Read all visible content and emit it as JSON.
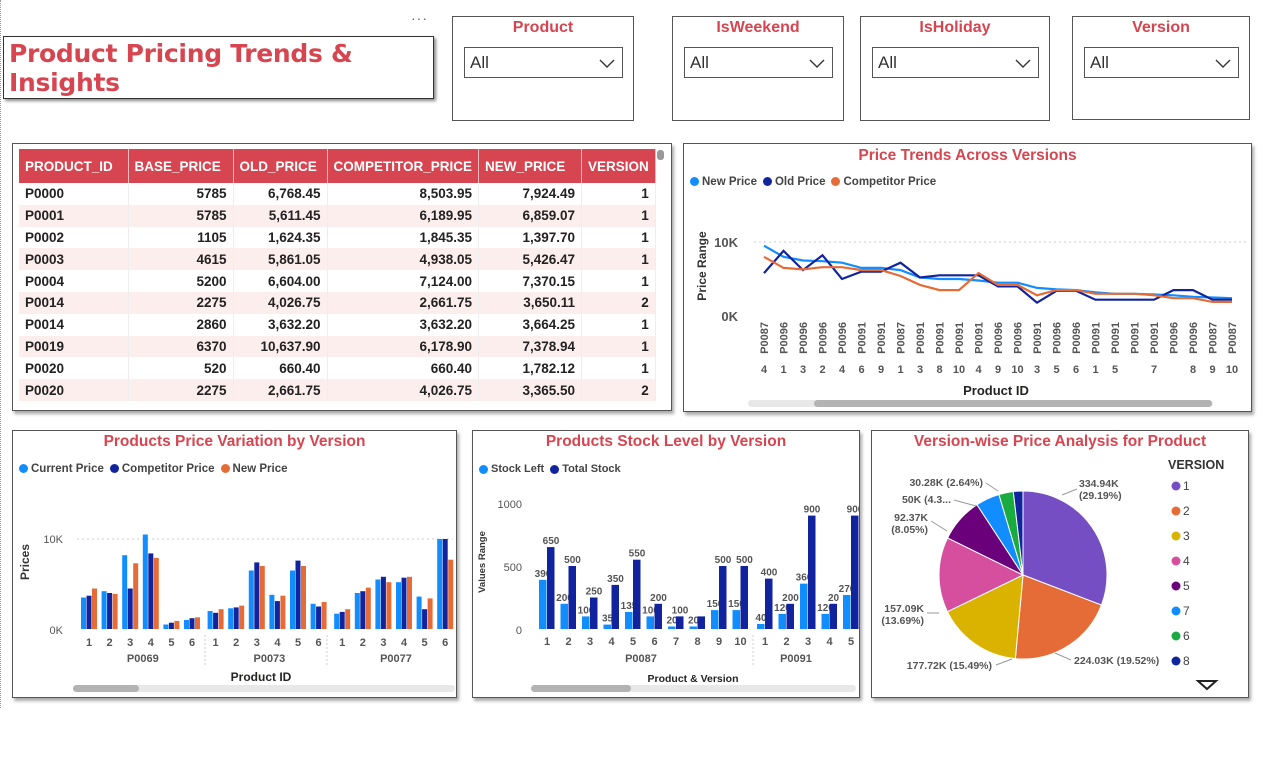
{
  "page": {
    "title": "Product Pricing Trends & Insights",
    "more_options": "···"
  },
  "slicers": [
    {
      "label": "Product",
      "value": "All"
    },
    {
      "label": "IsWeekend",
      "value": "All"
    },
    {
      "label": "IsHoliday",
      "value": "All"
    },
    {
      "label": "Version",
      "value": "All"
    }
  ],
  "table": {
    "columns": [
      "PRODUCT_ID",
      "BASE_PRICE",
      "OLD_PRICE",
      "COMPETITOR_PRICE",
      "NEW_PRICE",
      "VERSION"
    ],
    "rows": [
      [
        "P0000",
        "5785",
        "6,768.45",
        "8,503.95",
        "7,924.49",
        "1"
      ],
      [
        "P0001",
        "5785",
        "5,611.45",
        "6,189.95",
        "6,859.07",
        "1"
      ],
      [
        "P0002",
        "1105",
        "1,624.35",
        "1,845.35",
        "1,397.70",
        "1"
      ],
      [
        "P0003",
        "4615",
        "5,861.05",
        "4,938.05",
        "5,426.47",
        "1"
      ],
      [
        "P0004",
        "5200",
        "6,604.00",
        "7,124.00",
        "7,370.15",
        "1"
      ],
      [
        "P0014",
        "2275",
        "4,026.75",
        "2,661.75",
        "3,650.11",
        "2"
      ],
      [
        "P0014",
        "2860",
        "3,632.20",
        "3,632.20",
        "3,664.25",
        "1"
      ],
      [
        "P0019",
        "6370",
        "10,637.90",
        "6,178.90",
        "7,378.94",
        "1"
      ],
      [
        "P0020",
        "520",
        "660.40",
        "660.40",
        "1,782.12",
        "1"
      ],
      [
        "P0020",
        "2275",
        "2,661.75",
        "4,026.75",
        "3,365.50",
        "2"
      ]
    ]
  },
  "colors": {
    "accent": "#d64550",
    "light_blue": "#118dff",
    "dark_blue": "#12239e",
    "orange": "#e66c37"
  },
  "charts": {
    "trends": {
      "title": "Price Trends Across Versions",
      "legend": [
        "New Price",
        "Old Price",
        "Competitor Price"
      ],
      "xlabel": "Product ID",
      "ylabel": "Price Range",
      "yticks": [
        "10K",
        "0K"
      ]
    },
    "variation": {
      "title": "Products Price Variation by Version",
      "legend": [
        "Current Price",
        "Competitor Price",
        "New Price"
      ],
      "xlabel": "Product ID",
      "ylabel": "Prices",
      "yticks": [
        "10K",
        "0K"
      ]
    },
    "stock": {
      "title": "Products Stock Level by Version",
      "legend": [
        "Stock Left",
        "Total Stock"
      ],
      "xlabel": "Product & Version",
      "ylabel": "Values Range",
      "yticks": [
        "1000",
        "500",
        "0"
      ]
    },
    "pie": {
      "title": "Version-wise Price Analysis for Product",
      "legend_title": "VERSION",
      "labels": [
        "334.94K\n(29.19%)",
        "224.03K (19.52%)",
        "177.72K (15.49%)",
        "157.09K\n(13.69%)",
        "92.37K\n(8.05%)",
        "50K (4.3...",
        "30.28K (2.64%)"
      ]
    }
  },
  "chart_data": [
    {
      "type": "line",
      "title": "Price Trends Across Versions",
      "xlabel": "Product ID",
      "ylabel": "Price Range",
      "x": [
        "P0087 4",
        "P0096 1",
        "P0096 3",
        "P0096 2",
        "P0096 4",
        "P0091 6",
        "P0091 9",
        "P0087 1",
        "P0091 3",
        "P0091 8",
        "P0091 10",
        "P0091 4",
        "P0096 9",
        "P0096 10",
        "P0091 3",
        "P0096 5",
        "P0096 6",
        "P0091 1",
        "P0091 5",
        "P0091",
        "P0091 7",
        "P0096",
        "P0096 8",
        "P0087 9",
        "P0087 10"
      ],
      "x_tick_ids": [
        "P0087",
        "P0096",
        "P0096",
        "P0096",
        "P0096",
        "P0091",
        "P0091",
        "P0087",
        "P0091",
        "P0091",
        "P0091",
        "P0091",
        "P0096",
        "P0096",
        "P0091",
        "P0096",
        "P0096",
        "P0091",
        "P0091",
        "P0091",
        "P0091",
        "P0096",
        "P0096",
        "P0087",
        "P0087"
      ],
      "x_tick_nums": [
        "4",
        "1",
        "3",
        "2",
        "4",
        "6",
        "9",
        "1",
        "3",
        "8",
        "10",
        "4",
        "9",
        "10",
        "3",
        "5",
        "6",
        "1",
        "5",
        "",
        "7",
        "",
        "8",
        "9",
        "10"
      ],
      "ylim": [
        0,
        14000
      ],
      "series": [
        {
          "name": "New Price",
          "values": [
            9500,
            8000,
            7500,
            7400,
            7200,
            6500,
            6500,
            6200,
            5200,
            5000,
            5000,
            4800,
            4500,
            4500,
            3800,
            3600,
            3500,
            3200,
            3000,
            3000,
            2900,
            2800,
            2600,
            2500,
            2400
          ]
        },
        {
          "name": "Old Price",
          "values": [
            5800,
            8800,
            6200,
            8200,
            5000,
            6000,
            6000,
            7200,
            5200,
            5500,
            5500,
            5500,
            4000,
            4000,
            1800,
            3400,
            3400,
            2200,
            2200,
            2200,
            2200,
            3500,
            3500,
            2200,
            2200
          ]
        },
        {
          "name": "Competitor Price",
          "values": [
            8000,
            6500,
            6300,
            6600,
            6600,
            6200,
            6200,
            5400,
            4200,
            3500,
            3500,
            5800,
            4200,
            4200,
            2800,
            3500,
            3500,
            3000,
            3000,
            3000,
            2800,
            2400,
            2400,
            1900,
            1900
          ]
        }
      ]
    },
    {
      "type": "bar",
      "title": "Products Price Variation by Version",
      "xlabel": "Product ID",
      "ylabel": "Prices",
      "groups": [
        "P0069",
        "P0073",
        "P0077"
      ],
      "categories": [
        "1",
        "2",
        "3",
        "4",
        "5",
        "6",
        "1",
        "2",
        "3",
        "4",
        "5",
        "6",
        "1",
        "2",
        "3",
        "4",
        "5",
        "6"
      ],
      "ylim": [
        0,
        14000
      ],
      "series": [
        {
          "name": "Current Price",
          "values": [
            3500,
            4200,
            8200,
            10500,
            500,
            1000,
            2000,
            2300,
            6500,
            3800,
            6500,
            2800,
            1700,
            4000,
            5500,
            5200,
            3600,
            10000
          ]
        },
        {
          "name": "Competitor Price",
          "values": [
            3700,
            4000,
            4500,
            8400,
            700,
            1200,
            1800,
            2400,
            7400,
            3100,
            7600,
            2500,
            1900,
            4200,
            5800,
            5700,
            2200,
            10000
          ]
        },
        {
          "name": "New Price",
          "values": [
            4500,
            3900,
            7300,
            7900,
            900,
            1300,
            2200,
            2600,
            7000,
            3700,
            7000,
            3000,
            2200,
            4600,
            5200,
            5800,
            3400,
            7700
          ]
        }
      ]
    },
    {
      "type": "bar",
      "title": "Products Stock Level by Version",
      "xlabel": "Product & Version",
      "ylabel": "Values Range",
      "groups": [
        "P0087",
        "P0091"
      ],
      "categories": [
        "1",
        "2",
        "3",
        "4",
        "5",
        "6",
        "7",
        "8",
        "9",
        "10",
        "1",
        "2",
        "3",
        "4",
        "5"
      ],
      "ylim": [
        0,
        1000
      ],
      "series": [
        {
          "name": "Stock Left",
          "values": [
            390,
            200,
            100,
            35,
            135,
            100,
            20,
            20,
            150,
            150,
            40,
            120,
            360,
            120,
            270
          ],
          "labels": [
            "390",
            "200",
            "100",
            "35",
            "135",
            "100",
            "20",
            "20",
            "150",
            "150",
            "40",
            "120",
            "360",
            "120",
            "270"
          ]
        },
        {
          "name": "Total Stock",
          "values": [
            650,
            500,
            250,
            350,
            550,
            200,
            100,
            100,
            500,
            500,
            400,
            200,
            900,
            200,
            900
          ],
          "labels": [
            "650",
            "500",
            "250",
            "350",
            "550",
            "200",
            "100",
            "",
            "500",
            "500",
            "400",
            "200",
            "900",
            "20",
            "900"
          ]
        }
      ]
    },
    {
      "type": "pie",
      "title": "Version-wise Price Analysis for Product",
      "legend_title": "VERSION",
      "categories": [
        "1",
        "2",
        "3",
        "4",
        "5",
        "7",
        "6",
        "8"
      ],
      "values": [
        334940,
        224030,
        177720,
        157090,
        92370,
        50000,
        30280,
        20000
      ],
      "colors": [
        "#744ec2",
        "#e66c37",
        "#d9b300",
        "#d64f9f",
        "#6b007b",
        "#118dff",
        "#1aab40",
        "#12239e"
      ]
    }
  ]
}
